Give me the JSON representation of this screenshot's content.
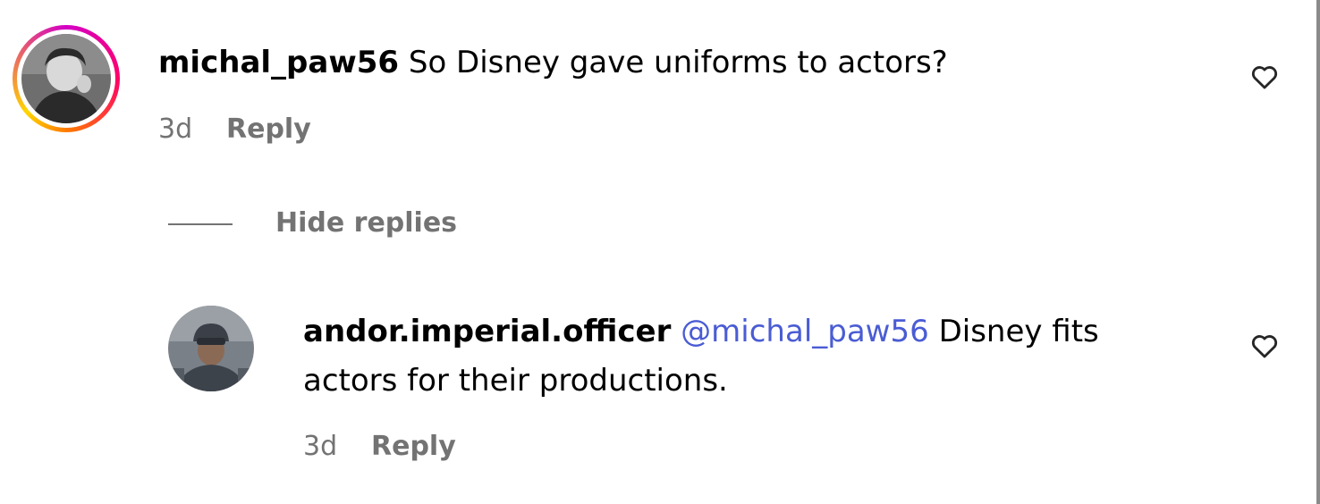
{
  "comments": [
    {
      "avatar_icon": "user-avatar-photo",
      "has_story_ring": true,
      "username": "michal_paw56",
      "text": "So Disney gave uniforms to actors?",
      "time": "3d",
      "reply_label": "Reply",
      "like_icon": "heart-outline-icon"
    }
  ],
  "replies_toggle": {
    "label": "Hide replies"
  },
  "replies": [
    {
      "avatar_icon": "user-avatar-photo",
      "username": "andor.imperial.officer",
      "mention": "@michal_paw56",
      "text_line1": "Disney fits",
      "text_line2": "actors for their productions.",
      "time": "3d",
      "reply_label": "Reply",
      "like_icon": "heart-outline-icon"
    }
  ],
  "colors": {
    "text": "#000000",
    "secondary": "#737373",
    "mention": "#4a5cd4",
    "story_ring_start": "#d300c5",
    "story_ring_end": "#ffd600"
  }
}
